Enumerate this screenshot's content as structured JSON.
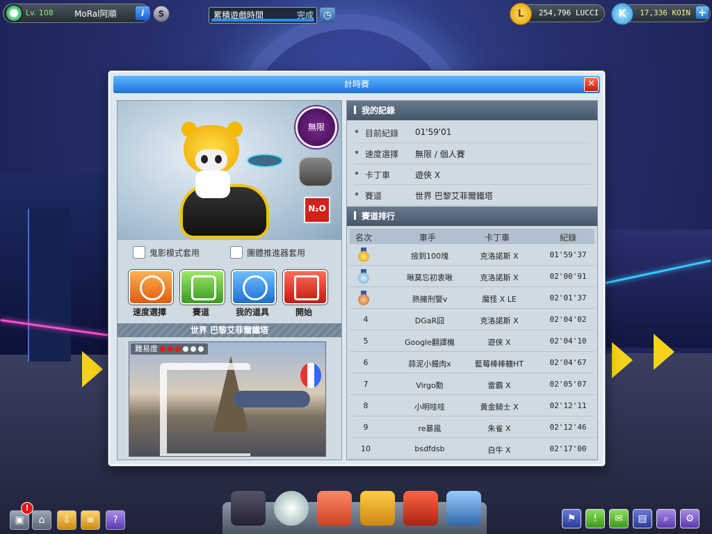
{
  "topbar": {
    "level": "Lv. 108",
    "nickname": "MoRal阿順",
    "info_label": "i",
    "s_label": "S",
    "playtime_label": "累積遊戲時間",
    "playtime_status": "完成",
    "lucci_symbol": "L",
    "lucci": "254,796 LUCCI",
    "koin_symbol": "K",
    "koin": "17,336 KOIN",
    "plus_label": "+"
  },
  "dialog": {
    "title": "計時賽",
    "close_label": "✕"
  },
  "preview": {
    "speed_orb": "無限",
    "n2o": "N₂O"
  },
  "options": {
    "ghost_mode": "鬼影模式套用",
    "team_booster": "團體推進器套用"
  },
  "actions": {
    "speed": "速度選擇",
    "track": "賽道",
    "items": "我的道具",
    "start": "開始"
  },
  "track": {
    "name": "世界 巴黎艾菲爾鐵塔",
    "difficulty_label": "難易度",
    "difficulty_level": 3,
    "difficulty_max": 6
  },
  "my_record": {
    "header": "我的記錄",
    "rows": [
      {
        "k": "目前紀錄",
        "v": "01'59'01"
      },
      {
        "k": "速度選擇",
        "v": "無限 / 個人賽"
      },
      {
        "k": "卡丁車",
        "v": "遊俠 X"
      },
      {
        "k": "賽道",
        "v": "世界 巴黎艾菲爾鐵塔"
      }
    ]
  },
  "ranking": {
    "header": "賽道排行",
    "columns": [
      "名次",
      "車手",
      "卡丁車",
      "紀錄"
    ],
    "rows": [
      {
        "pos": "1",
        "driver": "撿到100塊",
        "kart": "克洛諾斯 X",
        "time": "01'59'37"
      },
      {
        "pos": "2",
        "driver": "啾莫忘初衷啾",
        "kart": "克洛諾斯 X",
        "time": "02'00'91"
      },
      {
        "pos": "3",
        "driver": "熱擁刑警v",
        "kart": "魔怪 X LE",
        "time": "02'01'37"
      },
      {
        "pos": "4",
        "driver": "DGaR囧",
        "kart": "克洛諾斯 X",
        "time": "02'04'02"
      },
      {
        "pos": "5",
        "driver": "Google翻譯機",
        "kart": "遊俠 X",
        "time": "02'04'10"
      },
      {
        "pos": "6",
        "driver": "蒜泥小饅肉x",
        "kart": "藍莓棒棒糖HT",
        "time": "02'04'67"
      },
      {
        "pos": "7",
        "driver": "Virgo勳",
        "kart": "雷霸 X",
        "time": "02'05'07"
      },
      {
        "pos": "8",
        "driver": "小明哇哇",
        "kart": "黃金騎士 X",
        "time": "02'12'11"
      },
      {
        "pos": "9",
        "driver": "re暴風",
        "kart": "朱雀 X",
        "time": "02'12'46"
      },
      {
        "pos": "10",
        "driver": "bsdfdsb",
        "kart": "白牛 X",
        "time": "02'17'00"
      }
    ]
  },
  "bottom": {
    "alert_count": "!",
    "left_icons": [
      "world-icon",
      "home-icon",
      "download-icon",
      "notes-icon",
      "help-icon"
    ],
    "help_label": "?",
    "dock_icons": [
      "kart-garage-icon",
      "speedometer-icon",
      "garage-icon",
      "shop-icon",
      "toolbox-icon",
      "building-icon"
    ],
    "right_icons": [
      "flag-icon",
      "alert-icon",
      "chat-icon",
      "board-icon",
      "search-icon",
      "settings-icon"
    ],
    "alert_glyph": "!"
  },
  "colors": {
    "title_bar": "#1e73d6",
    "section_header": "#46576a",
    "level_text": "#8ef07a",
    "difficulty_on": "#e21c1c"
  }
}
